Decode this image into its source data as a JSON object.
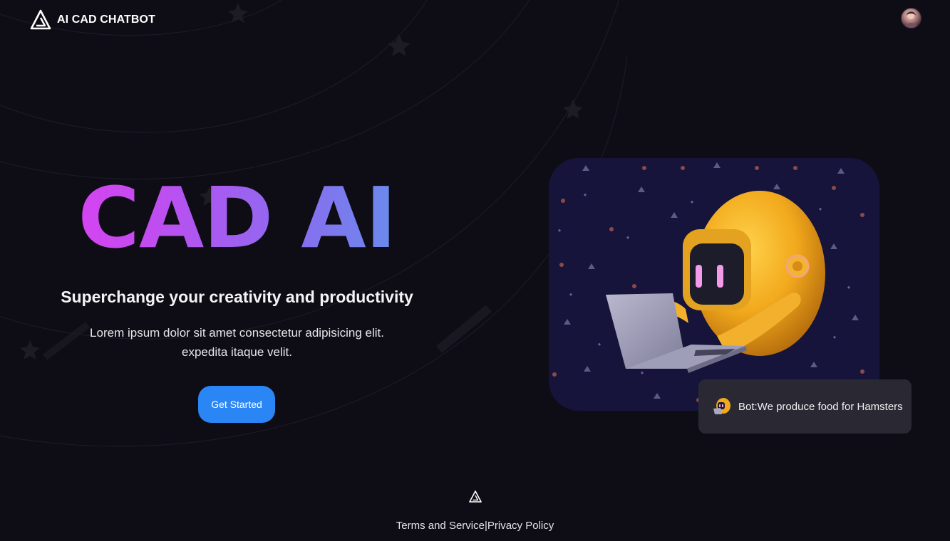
{
  "header": {
    "brand_name": "AI CAD CHATBOT",
    "logo_icon": "triangle-logo-icon",
    "avatar_icon": "user-avatar"
  },
  "hero": {
    "title": "CAD AI",
    "subtitle": "Superchange your creativity and productivity",
    "description": "Lorem ipsum dolor sit amet consectetur adipisicing elit. expedita itaque velit.",
    "cta_label": "Get Started"
  },
  "illustration": {
    "subject": "robot-with-laptop"
  },
  "chat_bubble": {
    "text": "Bot:We produce food for Hamsters",
    "icon": "bot-icon"
  },
  "footer": {
    "logo_icon": "triangle-logo-icon",
    "terms_label": "Terms and Service",
    "separator": "|",
    "privacy_label": "Privacy Policy"
  },
  "colors": {
    "background": "#0e0d15",
    "accent_blue": "#2a86f5",
    "title_gradient_start": "#e83cf0",
    "title_gradient_end": "#4fa3e6",
    "bubble_bg": "#2a2933"
  }
}
